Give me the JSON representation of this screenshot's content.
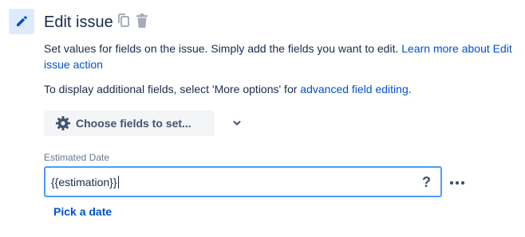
{
  "header": {
    "title": "Edit issue",
    "icons": [
      "pencil-icon",
      "copy-icon",
      "trash-icon"
    ],
    "accent_tile_color": "#deebff",
    "accent_icon_color": "#0052cc"
  },
  "description": {
    "text": "Set values for fields on the issue. Simply add the fields you want to edit. ",
    "link": "Learn more about Edit issue action"
  },
  "hint": {
    "text_before": "To display additional fields, select 'More options' for ",
    "link": "advanced field editing",
    "text_after": "."
  },
  "choose_fields": {
    "label": "Choose fields to set...",
    "icons": [
      "gear-icon",
      "chevron-down-icon"
    ]
  },
  "field": {
    "label": "Estimated Date",
    "value": "{{estimation}}",
    "help": "?",
    "focus_border_color": "#4c9aff",
    "more_icon": "more-dots-icon",
    "pick_date_label": "Pick a date"
  },
  "colors": {
    "link": "#0052cc",
    "text": "#172b4d",
    "muted": "#6b778c",
    "button_bg": "#f4f5f7"
  }
}
